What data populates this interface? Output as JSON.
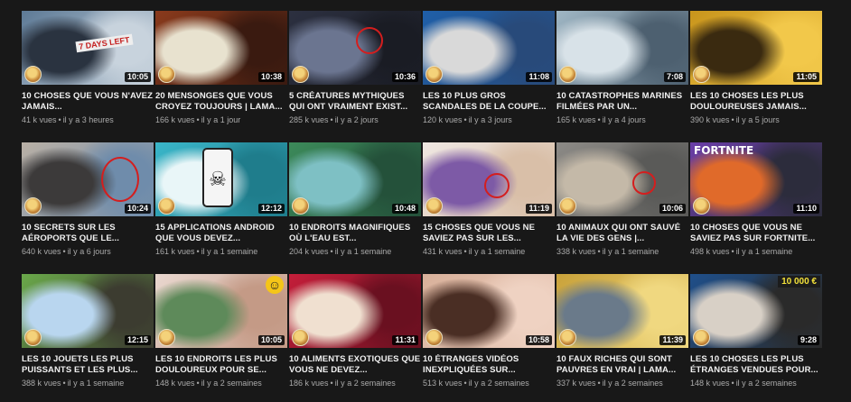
{
  "videos": [
    {
      "title": "10 CHOSES QUE VOUS N'AVEZ JAMAIS...",
      "views": "41 k vues",
      "age": "il y a 3 heures",
      "duration": "10:05",
      "colors": [
        "#5d7a96",
        "#2a3340",
        "#c8d3dd"
      ]
    },
    {
      "title": "20 MENSONGES QUE VOUS CROYEZ TOUJOURS | Lama...",
      "views": "166 k vues",
      "age": "il y a 1 jour",
      "duration": "10:38",
      "colors": [
        "#8a3a1c",
        "#e8e2cf",
        "#3a1a10"
      ]
    },
    {
      "title": "5 CRÉATURES MYTHIQUES QUI ONT VRAIMENT EXIST...",
      "views": "285 k vues",
      "age": "il y a 2 jours",
      "duration": "10:36",
      "colors": [
        "#2c3040",
        "#6b7590",
        "#1a1c24"
      ]
    },
    {
      "title": "LES 10 PLUS GROS SCANDALES DE LA COUPE...",
      "views": "120 k vues",
      "age": "il y a 3 jours",
      "duration": "11:08",
      "colors": [
        "#1f5fa8",
        "#d9d9d9",
        "#284a7a"
      ]
    },
    {
      "title": "10 CATASTROPHES MARINES FILMÉES PAR UN...",
      "views": "165 k vues",
      "age": "il y a 4 jours",
      "duration": "7:08",
      "colors": [
        "#9fb6c4",
        "#d8e2e8",
        "#4d6070"
      ]
    },
    {
      "title": "LES 10 CHOSES LES PLUS DOULOUREUSES JAMAIS...",
      "views": "390 k vues",
      "age": "il y a 5 jours",
      "duration": "11:05",
      "colors": [
        "#c9951c",
        "#3a2a10",
        "#f2c84a"
      ]
    },
    {
      "title": "10 SECRETS SUR LES AÉROPORTS QUE LE...",
      "views": "640 k vues",
      "age": "il y a 6 jours",
      "duration": "10:24",
      "colors": [
        "#b9b0a6",
        "#3c3a3a",
        "#6f8cab"
      ]
    },
    {
      "title": "15 APPLICATIONS ANDROID QUE VOUS DEVEZ...",
      "views": "161 k vues",
      "age": "il y a 1 semaine",
      "duration": "12:12",
      "colors": [
        "#3ab6c9",
        "#e9f6f8",
        "#1f7d8c"
      ]
    },
    {
      "title": "10 ENDROITS MAGNIFIQUES OÙ L'EAU EST...",
      "views": "204 k vues",
      "age": "il y a 1 semaine",
      "duration": "10:48",
      "colors": [
        "#3c8a5a",
        "#7ec0c4",
        "#24513a"
      ]
    },
    {
      "title": "15 CHOSES QUE VOUS NE SAVIEZ PAS SUR LES...",
      "views": "431 k vues",
      "age": "il y a 1 semaine",
      "duration": "11:19",
      "colors": [
        "#efe7e2",
        "#7d5aa6",
        "#d9bfa8"
      ]
    },
    {
      "title": "10 ANIMAUX QUI ONT SAUVÉ LA VIE DES GENS |...",
      "views": "338 k vues",
      "age": "il y a 1 semaine",
      "duration": "10:06",
      "colors": [
        "#8c8a86",
        "#c4b9a8",
        "#5a5a58"
      ]
    },
    {
      "title": "10 CHOSES QUE VOUS NE SAVIEZ PAS SUR FORTNITE...",
      "views": "498 k vues",
      "age": "il y a 1 semaine",
      "duration": "11:10",
      "colors": [
        "#6a3ea8",
        "#e06a2a",
        "#2c2c3c"
      ]
    },
    {
      "title": "LES 10 JOUETS LES PLUS PUISSANTS ET LES PLUS...",
      "views": "388 k vues",
      "age": "il y a 1 semaine",
      "duration": "12:15",
      "colors": [
        "#6aa84a",
        "#b9d6ef",
        "#3c3c30"
      ]
    },
    {
      "title": "LES 10 ENDROITS LES PLUS DOULOUREUX POUR SE...",
      "views": "148 k vues",
      "age": "il y a 2 semaines",
      "duration": "10:05",
      "colors": [
        "#e9d7cf",
        "#5e8a5a",
        "#c49a86"
      ]
    },
    {
      "title": "10 ALIMENTS EXOTIQUES QUE VOUS NE DEVEZ...",
      "views": "186 k vues",
      "age": "il y a 2 semaines",
      "duration": "11:31",
      "colors": [
        "#c41e3a",
        "#f0e0d0",
        "#6a1020"
      ]
    },
    {
      "title": "10 ÉTRANGES VIDÉOS INEXPLIQUÉES SUR...",
      "views": "513 k vues",
      "age": "il y a 2 semaines",
      "duration": "10:58",
      "colors": [
        "#d8b09a",
        "#4a2e24",
        "#efd2c2"
      ]
    },
    {
      "title": "10 FAUX RICHES QUI SONT PAUVRES EN VRAI | Lama...",
      "views": "337 k vues",
      "age": "il y a 2 semaines",
      "duration": "11:39",
      "colors": [
        "#c9a23a",
        "#6a7a8a",
        "#f0d880"
      ]
    },
    {
      "title": "LES 10 CHOSES LES PLUS ÉTRANGES VENDUES POUR...",
      "views": "148 k vues",
      "age": "il y a 2 semaines",
      "duration": "9:28",
      "colors": [
        "#1f4f8a",
        "#d8d0c6",
        "#2a2a2a"
      ]
    }
  ],
  "badges": {
    "price_tag": "10 000 €",
    "sign_text": "7 DAYS LEFT",
    "fortnite_text": "FORTNITE"
  },
  "separator": "•"
}
